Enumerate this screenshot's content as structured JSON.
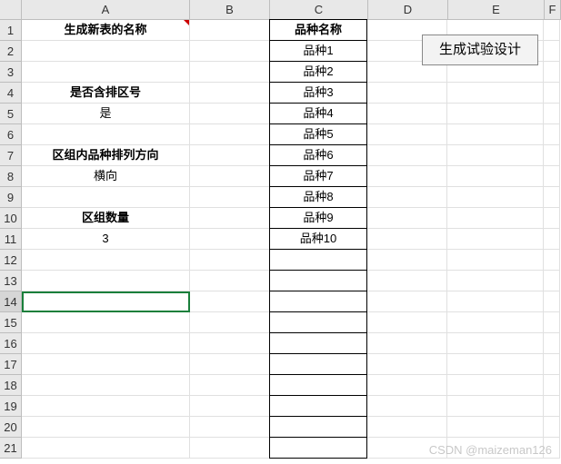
{
  "columns": [
    "A",
    "B",
    "C",
    "D",
    "E",
    "F"
  ],
  "col_widths": [
    "w-a",
    "w-b",
    "w-c",
    "w-d",
    "w-e",
    "w-f"
  ],
  "row_count": 21,
  "selected_row": 14,
  "a_cells": {
    "1": {
      "text": "生成新表的名称",
      "bold": true,
      "comment": true
    },
    "4": {
      "text": "是否含排区号",
      "bold": true
    },
    "5": {
      "text": "是"
    },
    "7": {
      "text": "区组内品种排列方向",
      "bold": true
    },
    "8": {
      "text": "横向"
    },
    "10": {
      "text": "区组数量",
      "bold": true
    },
    "11": {
      "text": "3"
    }
  },
  "c_header": "品种名称",
  "c_items": [
    "品种1",
    "品种2",
    "品种3",
    "品种4",
    "品种5",
    "品种6",
    "品种7",
    "品种8",
    "品种9",
    "品种10"
  ],
  "c_bordered_until": 21,
  "button_label": "生成试验设计",
  "watermark": "CSDN @maizeman126"
}
